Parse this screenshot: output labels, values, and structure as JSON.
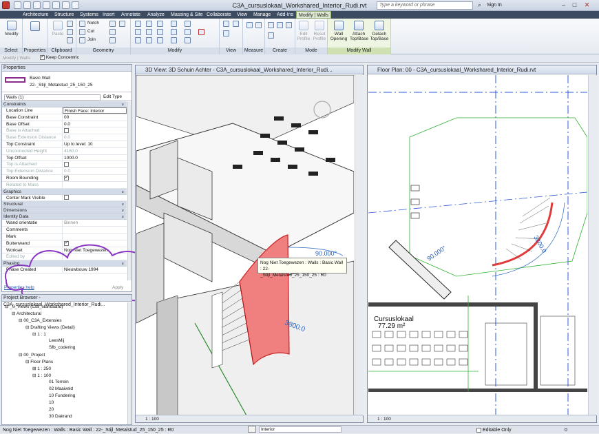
{
  "app": {
    "title": "C3A_cursuslokaal_Workshared_Interior_Rudi.rvt",
    "search_placeholder": "Type a keyword or phrase",
    "sign_in": "Sign In"
  },
  "ribbon_tabs": [
    "Architecture",
    "Structure",
    "Systems",
    "Insert",
    "Annotate",
    "Analyze",
    "Massing & Site",
    "Collaborate",
    "View",
    "Manage",
    "Add-Ins",
    "Modify | Walls"
  ],
  "ribbon": {
    "select": {
      "caption": "Select",
      "modify": "Modify"
    },
    "properties": {
      "caption": "Properties",
      "label": "Properties"
    },
    "clipboard": {
      "caption": "Clipboard",
      "paste": "Paste"
    },
    "geometry": {
      "caption": "Geometry",
      "notch": "Notch",
      "cut": "Cut",
      "join": "Join"
    },
    "modify": {
      "caption": "Modify"
    },
    "view": {
      "caption": "View"
    },
    "measure": {
      "caption": "Measure"
    },
    "create": {
      "caption": "Create"
    },
    "mode": {
      "caption": "Mode",
      "edit_profile": "Edit Profile",
      "reset_profile": "Reset Profile"
    },
    "modify_wall": {
      "caption": "Modify Wall",
      "wall_opening": "Wall Opening",
      "attach": "Attach Top/Base",
      "detach": "Detach Top/Base"
    }
  },
  "options_bar": {
    "context": "Modify | Walls",
    "keep_concentric": "Keep Concentric"
  },
  "properties": {
    "header": "Properties",
    "type_family": "Basic Wall",
    "type_name": "22-_Stijl_Metalstud_25_150_25",
    "selector": "Walls (1)",
    "edit_type": "Edit Type",
    "groups": [
      {
        "name": "Constraints",
        "rows": [
          {
            "k": "Location Line",
            "v": "Finish Face: Interior"
          },
          {
            "k": "Base Constraint",
            "v": "00"
          },
          {
            "k": "Base Offset",
            "v": "0.0"
          },
          {
            "k": "Base is Attached",
            "v": ""
          },
          {
            "k": "Base Extension Distance",
            "v": "0.0"
          },
          {
            "k": "Top Constraint",
            "v": "Up to level: 10"
          },
          {
            "k": "Unconnected Height",
            "v": "4160.0"
          },
          {
            "k": "Top Offset",
            "v": "1000.0"
          },
          {
            "k": "Top is Attached",
            "v": ""
          },
          {
            "k": "Top Extension Distance",
            "v": "0.0"
          },
          {
            "k": "Room Bounding",
            "v": ""
          },
          {
            "k": "Related to Mass",
            "v": ""
          }
        ]
      },
      {
        "name": "Graphics",
        "rows": [
          {
            "k": "Center Mark Visible",
            "v": ""
          }
        ]
      },
      {
        "name": "Structural",
        "rows": []
      },
      {
        "name": "Dimensions",
        "rows": []
      },
      {
        "name": "Identity Data",
        "rows": [
          {
            "k": "Wand orientatie",
            "v": "Binnen"
          },
          {
            "k": "Comments",
            "v": ""
          },
          {
            "k": "Mark",
            "v": ""
          },
          {
            "k": "Buitenwand",
            "v": ""
          },
          {
            "k": "Workset",
            "v": "Nog Niet Toegewezen"
          },
          {
            "k": "Edited by",
            "v": ""
          }
        ]
      },
      {
        "name": "Phasing",
        "rows": [
          {
            "k": "Phase Created",
            "v": "Nieuwbouw 1994"
          }
        ]
      }
    ],
    "help": "Properties help",
    "apply": "Apply"
  },
  "browser": {
    "header": "Project Browser - C3A_cursuslokaal_Workshared_Interior_Rudi...",
    "nodes": [
      "_0_Views (c3a_standaard)",
      "Architectural",
      "00_C3A_Extensies",
      "Drafting Views (Detail)",
      "1 : 1",
      "LeesMij",
      "Sfb_codering",
      "00_Project",
      "Floor Plans",
      "1 : 250",
      "1 : 100",
      "01 Terrein",
      "02 Maaiveld",
      "10 Fundering",
      "10",
      "20",
      "30 Dakrand"
    ]
  },
  "view3d": {
    "title": "3D View: 3D Schuin Achter - C3A_cursuslokaal_Workshared_Interior_Rudi...",
    "scale": "1 : 100",
    "tooltip_line1": "Nog Niet Toegewezen : Walls : Basic Wall : 22-",
    "tooltip_line2": "_Stijl_Metalstud_25_150_25 : R0",
    "dim_angle": "90.000°",
    "dim_len": "3800.0"
  },
  "viewplan": {
    "title": "Floor Plan: 00 - C3A_cursuslokaal_Workshared_Interior_Rudi.rvt",
    "scale": "1 : 100",
    "room_name": "Cursuslokaal",
    "room_area": "77.29 m²",
    "dim_angle": "90.000°",
    "dim_len": "3800.0"
  },
  "status": {
    "text": "Nog Niet Toegewezen : Walls : Basic Wall : 22-_Stijl_Metalstud_25_150_25 : R0",
    "workset": "Interior",
    "editable": "Editable Only",
    "count": "0"
  },
  "colors": {
    "accent": "#e03a3a",
    "annot": "#8a35c2",
    "ribbon_dark": "#3d4b61",
    "context": "#cfe0b3"
  }
}
